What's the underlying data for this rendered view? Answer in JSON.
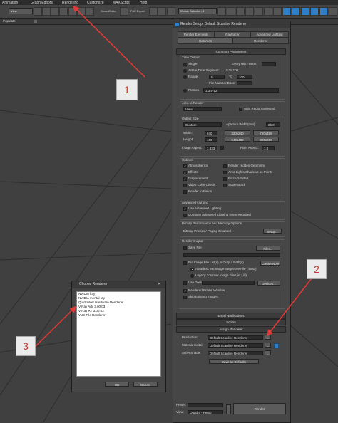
{
  "menubar": {
    "items": [
      "Animation",
      "Graph Editors",
      "Rendering",
      "Customize",
      "MAXScript",
      "Help"
    ]
  },
  "toolbar": {
    "view_dropdown": "View",
    "steam_roller": "SteamRoller",
    "fbx_export": "FBX Export",
    "selection_set": "Create Selection S"
  },
  "ribbon": {
    "populate": "Populate"
  },
  "render_setup": {
    "title": "Render Setup: Default Scanline Renderer",
    "tabs_row1": [
      "Render Elements",
      "Raytracer",
      "Advanced Lighting"
    ],
    "tabs_row2": [
      "Common",
      "Renderer"
    ],
    "common_parameters": "Common Parameters",
    "time_output": {
      "label": "Time Output",
      "single": "Single",
      "every_nth_frame": "Every Nth Frame:",
      "active_time_segment": "Active Time Segment:",
      "active_range": "0 To 100",
      "range": "Range:",
      "range_from": "0",
      "range_to_label": "To",
      "range_to": "100",
      "file_number_base": "File Number Base:",
      "frames": "Frames",
      "frames_value": "1,3,5-12"
    },
    "area_to_render": {
      "label": "Area to Render",
      "value": "View",
      "auto_region": "Auto Region Selected"
    },
    "output_size": {
      "label": "Output Size",
      "preset": "Custom",
      "aperture_label": "Aperture Width(mm):",
      "aperture_value": "36.0",
      "width_label": "Width:",
      "width_value": "640",
      "height_label": "Height:",
      "height_value": "480",
      "presets": [
        "320x240",
        "720x486",
        "640x480",
        "800x600"
      ],
      "image_aspect_label": "Image Aspect:",
      "image_aspect_value": "1.333",
      "pixel_aspect_label": "Pixel Aspect:",
      "pixel_aspect_value": "1.0"
    },
    "options": {
      "label": "Options",
      "left": [
        "Atmospherics",
        "Effects",
        "Displacement",
        "Video Color Check",
        "Render to Fields"
      ],
      "right": [
        "Render Hidden Geometry",
        "Area Lights/Shadows as Points",
        "Force 2-Sided",
        "Super Black"
      ]
    },
    "advanced_lighting": {
      "label": "Advanced Lighting",
      "use": "Use Advanced Lighting",
      "compute": "Compute Advanced Lighting when Required"
    },
    "bitmap_perf": {
      "label": "Bitmap Performance and Memory Options",
      "status": "Bitmap Proxies / Paging Disabled",
      "setup": "Setup..."
    },
    "render_output": {
      "label": "Render Output",
      "save_file": "Save File",
      "files": "Files...",
      "put_image": "Put Image File List(s) in Output Path(s)",
      "create_now": "Create Now",
      "autodesk_me": "Autodesk ME Image Sequence File (.imsq)",
      "legacy": "Legacy 3ds max Image File List (.ifl)",
      "use_device": "Use Device",
      "devices": "Devices...",
      "rendered_frame_window": "Rendered Frame Window",
      "skip_existing": "Skip Existing Images"
    },
    "email": "Email Notifications",
    "scripts": "Scripts",
    "assign_renderer": {
      "label": "Assign Renderer",
      "production_label": "Production:",
      "production_value": "Default Scanline Renderer",
      "material_label": "Material Editor:",
      "material_value": "Default Scanline Renderer",
      "activeshade_label": "ActiveShade:",
      "activeshade_value": "Default Scanline Renderer",
      "ellipsis": "...",
      "save_defaults": "Save as Defaults"
    },
    "footer": {
      "preset_label": "Preset:",
      "view_label": "View:",
      "view_value": "Quad 4 - Persp",
      "render": "Render"
    }
  },
  "choose_renderer": {
    "title": "Choose Renderer",
    "items": [
      "NVIDIA iray",
      "NVIDIA mental ray",
      "Quicksilver Hardware Renderer",
      "V-Ray Adv 3.00.03",
      "V-Ray RT 3.00.03",
      "VUE File Renderer"
    ],
    "ok": "OK",
    "cancel": "Cancel"
  },
  "callouts": [
    "1",
    "2",
    "3"
  ],
  "colors": {
    "arrow": "#e53935",
    "dialog_bg": "#464646",
    "selection_blue": "#2d7fc8"
  }
}
